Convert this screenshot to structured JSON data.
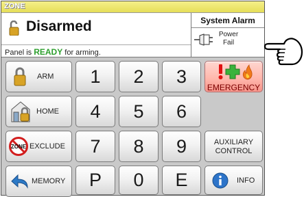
{
  "zone_bar": {
    "label": "ZONE"
  },
  "status": {
    "title": "Disarmed",
    "message_prefix": "Panel is",
    "message_state": "READY",
    "message_suffix": "for arming.",
    "state_color": "#2e9f2e"
  },
  "system_alarm": {
    "title": "System Alarm",
    "line1": "Power",
    "line2": "Fail",
    "icon": "power-plug-icon"
  },
  "side_buttons": {
    "arm": "ARM",
    "home": "HOME",
    "exclude": "EXCLUDE",
    "exclude_icon_text": "ZONE",
    "memory": "MEMORY"
  },
  "keypad": {
    "k1": "1",
    "k2": "2",
    "k3": "3",
    "k4": "4",
    "k5": "5",
    "k6": "6",
    "k7": "7",
    "k8": "8",
    "k9": "9",
    "kp": "P",
    "k0": "0",
    "ke": "E"
  },
  "right_buttons": {
    "emergency": "EMERGENCY",
    "aux_line1": "AUXILIARY",
    "aux_line2": "CONTROL",
    "info": "INFO"
  },
  "colors": {
    "zone_bar": "#e6de58",
    "emergency": "#f7948a",
    "panel_bg": "#c9c9c9"
  }
}
